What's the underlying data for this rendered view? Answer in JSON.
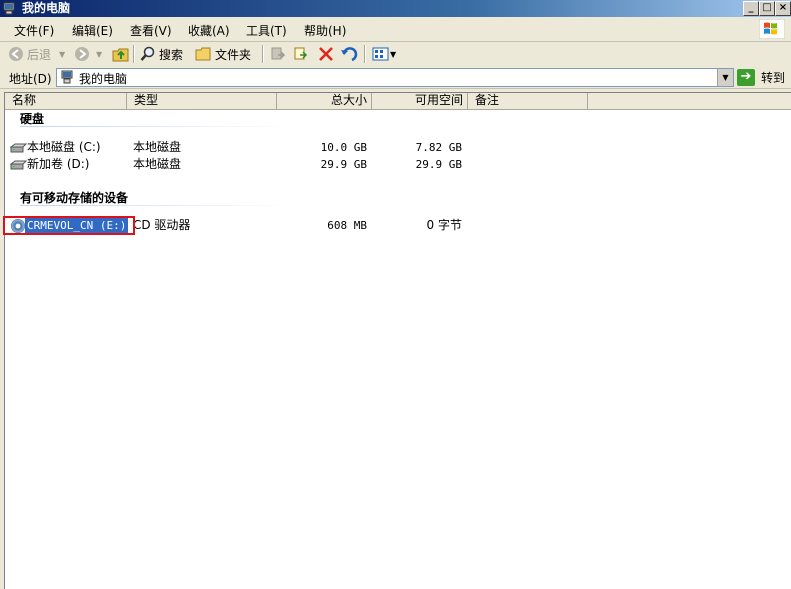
{
  "window": {
    "title": "我的电脑",
    "minimize": "_",
    "maximize": "□",
    "close": "×"
  },
  "menu": [
    "文件(F)",
    "编辑(E)",
    "查看(V)",
    "收藏(A)",
    "工具(T)",
    "帮助(H)"
  ],
  "toolbar": {
    "back": "后退",
    "search": "搜索",
    "folders": "文件夹"
  },
  "address": {
    "label": "地址(D)",
    "value": "我的电脑",
    "go": "转到"
  },
  "columns": [
    "名称",
    "类型",
    "总大小",
    "可用空间",
    "备注"
  ],
  "groups": {
    "hdd": {
      "title": "硬盘",
      "items": [
        {
          "name": "本地磁盘 (C:)",
          "type": "本地磁盘",
          "total": "10.0 GB",
          "free": "7.82 GB"
        },
        {
          "name": "新加卷 (D:)",
          "type": "本地磁盘",
          "total": "29.9 GB",
          "free": "29.9 GB"
        }
      ]
    },
    "removable": {
      "title": "有可移动存储的设备",
      "items": [
        {
          "name": "CRMEVOL_CN (E:)",
          "type": "CD 驱动器",
          "total": "608 MB",
          "free": "0 字节"
        }
      ]
    }
  },
  "colors": {
    "selection": "#316ac5",
    "highlight_border": "#e0101a"
  }
}
